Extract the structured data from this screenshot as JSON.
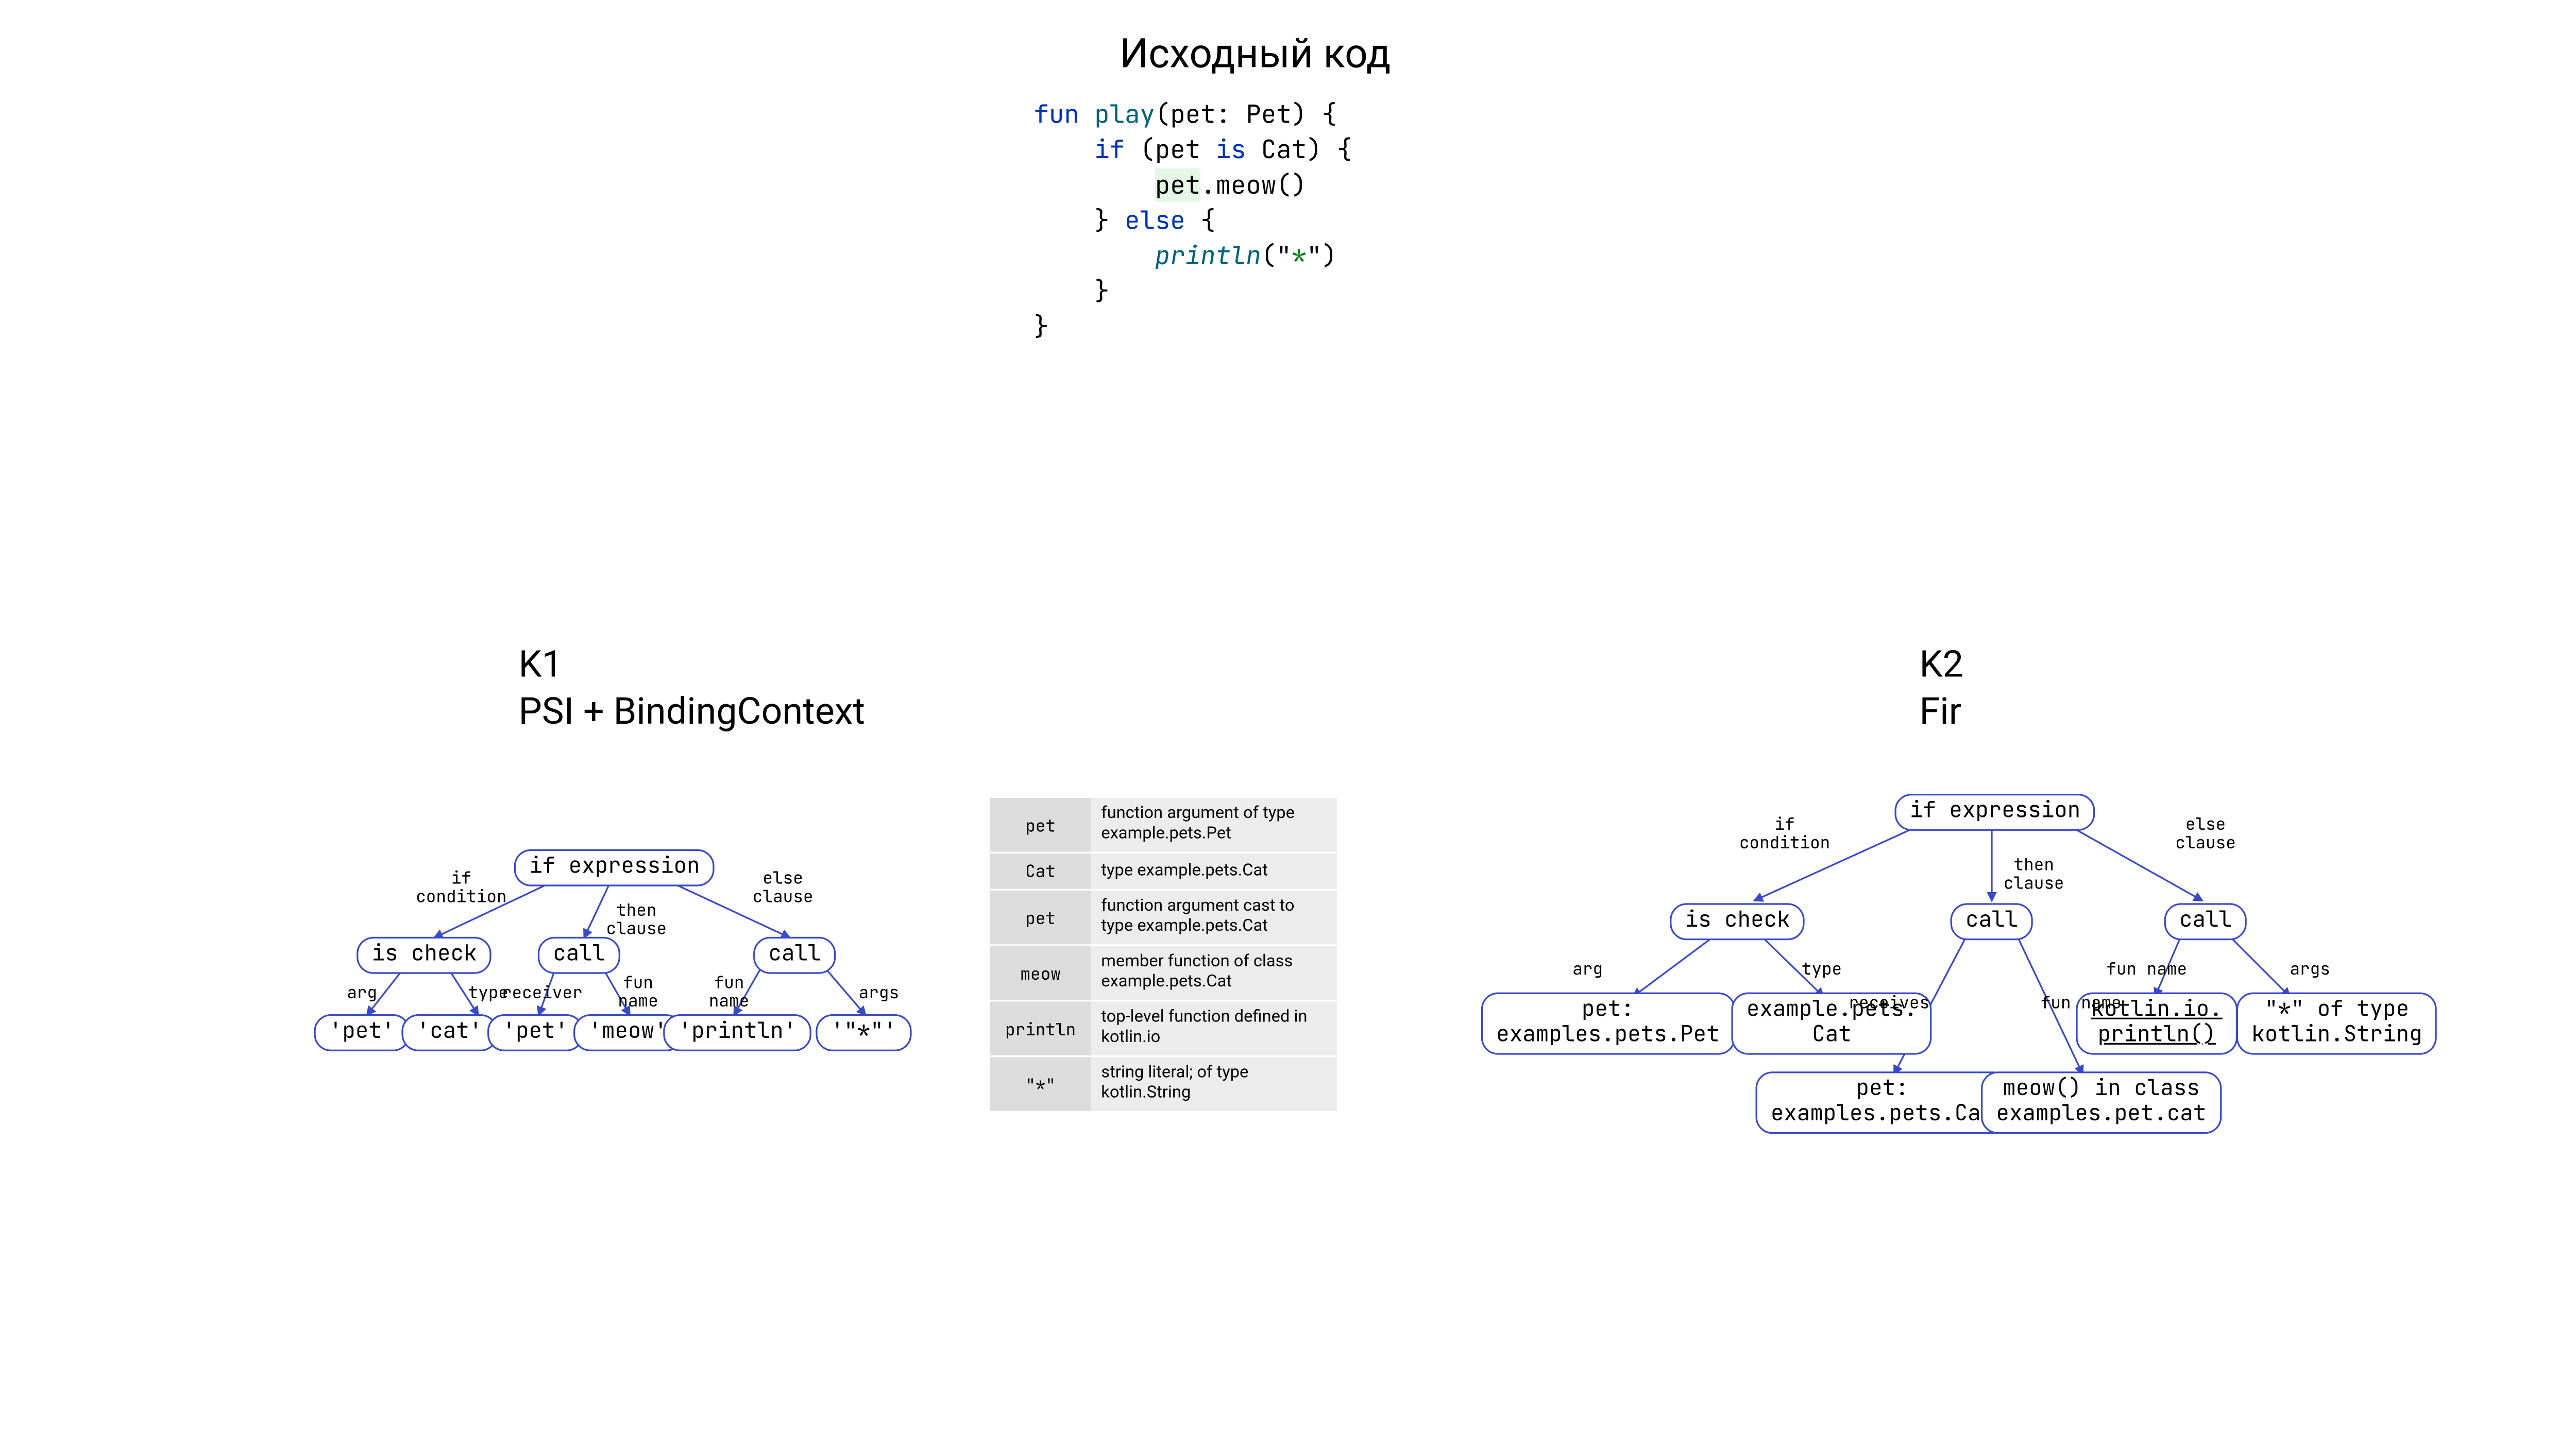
{
  "heading_source": "Исходный код",
  "code": {
    "kw_fun": "fun",
    "fn_play": "play",
    "sig": "(pet: Pet) {",
    "kw_if": "    if",
    "if_cond": " (pet ",
    "kw_is": "is",
    "if_cond2": " Cat) {",
    "line_pet": "        ",
    "pet_hl": "pet",
    "dot_meow": ".meow()",
    "close_then": "    }",
    "kw_else": " else",
    "else_open": " {",
    "line_println": "        ",
    "fn_println": "println",
    "println_arg": "(\"",
    "str_star": "*",
    "println_arg2": "\")",
    "close_else": "    }",
    "close_fun": "}"
  },
  "k1": {
    "label1": "K1",
    "label2": "PSI + BindingContext",
    "nodes": {
      "root": "if expression",
      "ischeck": "is check",
      "call_then": "call",
      "call_else": "call",
      "pet1": "'pet'",
      "cat": "'cat'",
      "pet2": "'pet'",
      "meow": "'meow'",
      "println": "'println'",
      "star": "'\"*\"'"
    },
    "edges": {
      "ifcond": "if\ncondition",
      "then": "then\nclause",
      "else_": "else\nclause",
      "arg": "arg",
      "type": "type",
      "receiver": "receiver",
      "funname1": "fun\nname",
      "funname2": "fun\nname",
      "args": "args"
    }
  },
  "bc_rows": [
    {
      "k": "pet",
      "v": "function argument of type example.pets.Pet"
    },
    {
      "k": "Cat",
      "v": "type example.pets.Cat"
    },
    {
      "k": "pet",
      "v": "function argument cast to type example.pets.Cat"
    },
    {
      "k": "meow",
      "v": "member function of class example.pets.Cat"
    },
    {
      "k": "println",
      "v": "top-level function defined in kotlin.io"
    },
    {
      "k": "\"*\"",
      "v": "string literal; of type kotlin.String"
    }
  ],
  "k2": {
    "label1": "K2",
    "label2": "Fir",
    "nodes": {
      "root": "if expression",
      "ischeck": "is check",
      "petPet": "pet:\nexamples.pets.Pet",
      "catType": "example.pets.\nCat",
      "call_then": "call",
      "petCat": "pet:\nexamples.pets.Cat",
      "meowInCat": "meow() in class\nexamples.pet.cat",
      "call_else": "call",
      "kioPrintln": "kotlin.io.\nprintln()",
      "starStr": "\"*\" of type\nkotlin.String"
    },
    "edges": {
      "ifcond": "if\ncondition",
      "then": "then\nclause",
      "else_": "else\nclause",
      "arg": "arg",
      "type": "type",
      "receives": "receives",
      "funname1": "fun name",
      "funname2": "fun name",
      "args": "args"
    }
  }
}
